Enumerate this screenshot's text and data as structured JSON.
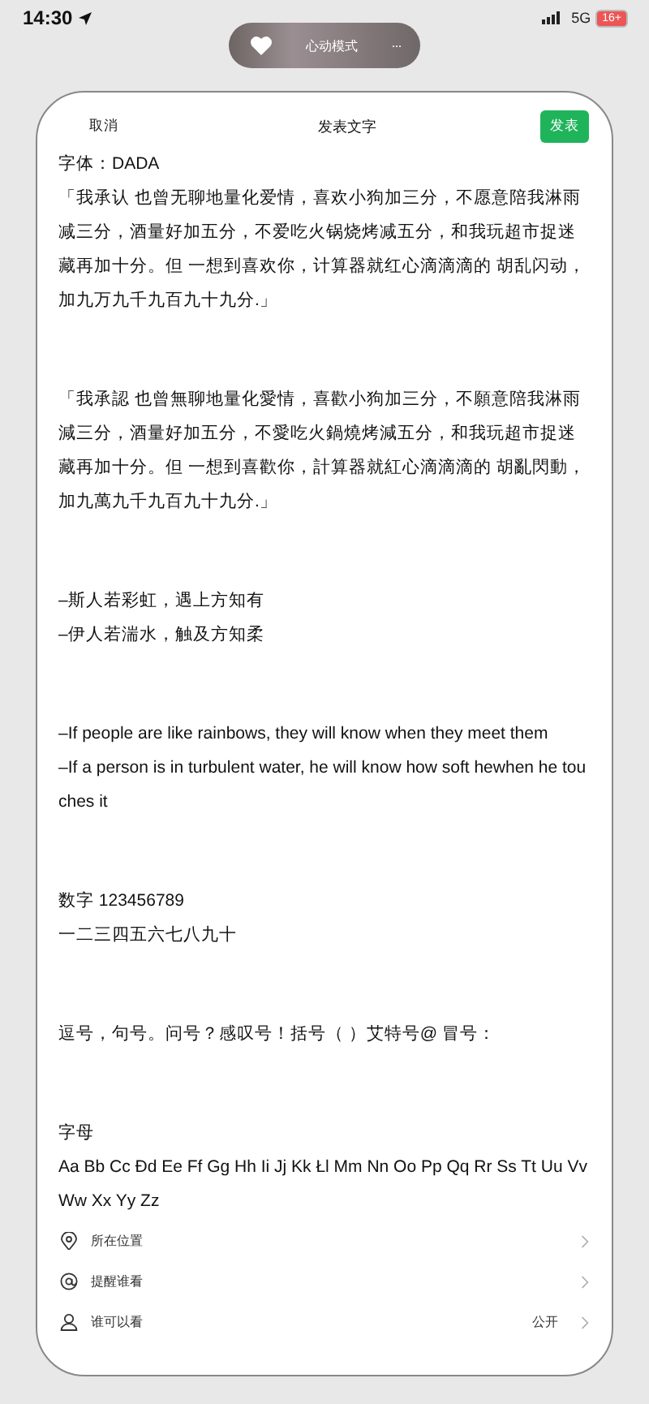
{
  "status_bar": {
    "time": "14:30",
    "network": "5G",
    "battery": "16+"
  },
  "pill": {
    "label": "心动模式",
    "more": "···"
  },
  "header": {
    "cancel": "取消",
    "title": "发表文字",
    "publish": "发表"
  },
  "blocks": [
    {
      "paragraphs": [
        "字体：DADA",
        "「我承认 也曾无聊地量化爱情，喜欢小狗加三分，不愿意陪我淋雨减三分，酒量好加五分，不爱吃火锅烧烤减五分，和我玩超市捉迷藏再加十分。但 一想到喜欢你，计算器就红心滴滴滴的 胡乱闪动，加九万九千九百九十九分.」"
      ]
    },
    {
      "paragraphs": [
        "「我承認 也曾無聊地量化愛情，喜歡小狗加三分，不願意陪我淋雨減三分，酒量好加五分，不愛吃火鍋燒烤減五分，和我玩超市捉迷藏再加十分。但 一想到喜歡你，計算器就紅心滴滴滴的 胡亂閃動，加九萬九千九百九十九分.」"
      ]
    },
    {
      "paragraphs": [
        "–斯人若彩虹，遇上方知有",
        "–伊人若湍水，触及方知柔"
      ]
    },
    {
      "paragraphs": [
        "–If people are like rainbows, they will know when they meet them",
        "–If a person is in turbulent water, he will know how soft hewhen he touches it"
      ]
    },
    {
      "paragraphs": [
        "数字 123456789",
        "一二三四五六七八九十"
      ]
    },
    {
      "paragraphs": [
        "逗号，句号。问号？感叹号！括号（ ）艾特号@ 冒号："
      ]
    },
    {
      "paragraphs": [
        "字母",
        "Aa Bb Cc Đd Ee Ff Gg Hh Ii Jj Kk Łl Mm Nn Oo Pp Qq Rr Ss Tt Uu Vv Ww Xx Yy Zz"
      ]
    }
  ],
  "options": [
    {
      "kind": "location",
      "label": "所在位置"
    },
    {
      "kind": "mention",
      "label": "提醒谁看"
    },
    {
      "kind": "visibility",
      "label": "谁可以看",
      "value": "公开"
    }
  ]
}
